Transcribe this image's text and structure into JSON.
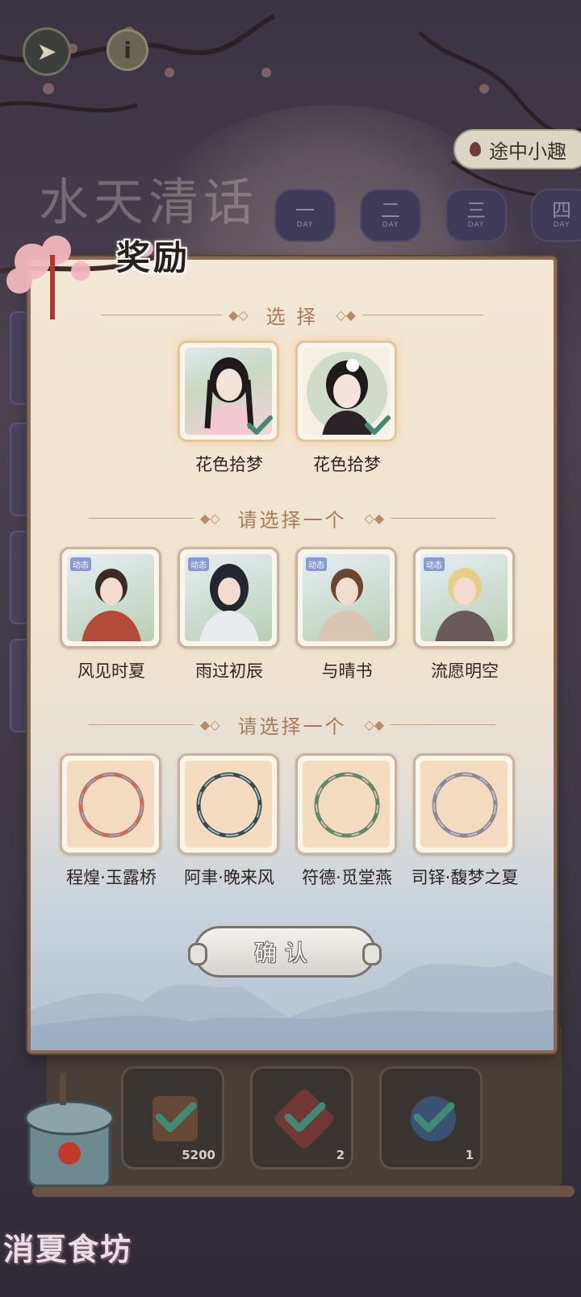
{
  "top_bar": {
    "back_icon": "back-arrow-icon",
    "info_icon": "info-icon",
    "info_glyph": "i",
    "event_label": "途中小趣"
  },
  "background": {
    "title": "水天清话",
    "days": [
      {
        "label": "一",
        "sub": "DAY"
      },
      {
        "label": "二",
        "sub": "DAY"
      },
      {
        "label": "三",
        "sub": "DAY"
      },
      {
        "label": "四",
        "sub": "DAY"
      }
    ]
  },
  "panel": {
    "title": "奖励",
    "section1": {
      "label": "选 择",
      "items": [
        {
          "name": "花色拾梦",
          "selected": true,
          "kind": "portrait"
        },
        {
          "name": "花色拾梦",
          "selected": true,
          "kind": "avatar"
        }
      ]
    },
    "section2": {
      "label": "请选择一个",
      "items": [
        {
          "name": "风见时夏",
          "tag": "动态"
        },
        {
          "name": "雨过初辰",
          "tag": "动态"
        },
        {
          "name": "与晴书",
          "tag": "动态"
        },
        {
          "name": "流愿明空",
          "tag": "动态"
        }
      ]
    },
    "section3": {
      "label": "请选择一个",
      "items": [
        {
          "name": "程煌·玉露桥"
        },
        {
          "name": "阿聿·晚来风"
        },
        {
          "name": "符德·觅堂燕"
        },
        {
          "name": "司铎·馥梦之夏"
        }
      ]
    },
    "confirm_label": "确认"
  },
  "bottom": {
    "rewards": [
      {
        "count": "5200",
        "claimed": true,
        "color": "#8a5a3a"
      },
      {
        "count": "2",
        "claimed": true,
        "color": "#9a3a3a"
      },
      {
        "count": "1",
        "claimed": true,
        "color": "#3a6aa8"
      }
    ],
    "shop_label": "消夏食坊"
  },
  "colors": {
    "accent": "#a77c5a",
    "check": "#3f8a74"
  }
}
